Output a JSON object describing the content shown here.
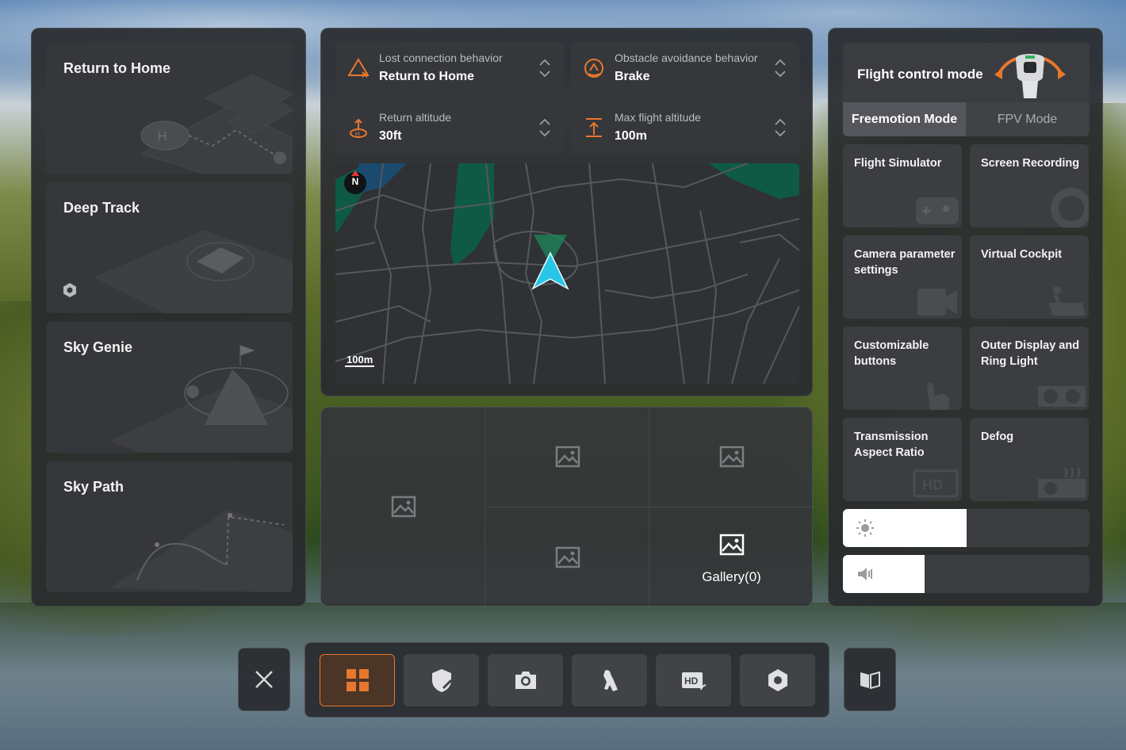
{
  "left_panel": {
    "modes": [
      {
        "label": "Return to Home"
      },
      {
        "label": "Deep Track"
      },
      {
        "label": "Sky Genie"
      },
      {
        "label": "Sky Path"
      }
    ]
  },
  "settings": {
    "lost_connection": {
      "label": "Lost connection behavior",
      "value": "Return to Home"
    },
    "obstacle_avoidance": {
      "label": "Obstacle avoidance behavior",
      "value": "Brake"
    },
    "return_altitude": {
      "label": "Return altitude",
      "value": "30ft"
    },
    "max_altitude": {
      "label": "Max flight altitude",
      "value": "100m"
    }
  },
  "map": {
    "compass": "N",
    "scale": "100m"
  },
  "gallery": {
    "label": "Gallery(0)"
  },
  "flight_control": {
    "title": "Flight control mode",
    "modes": [
      "Freemotion Mode",
      "FPV Mode"
    ],
    "selected": "Freemotion Mode"
  },
  "tiles": [
    {
      "label": "Flight Simulator",
      "icon": "gamepad-icon"
    },
    {
      "label": "Screen Recording",
      "icon": "record-icon"
    },
    {
      "label": "Camera parameter settings",
      "icon": "camera-icon"
    },
    {
      "label": "Virtual Cockpit",
      "icon": "cockpit-icon"
    },
    {
      "label": "Customizable buttons",
      "icon": "hand-button-icon"
    },
    {
      "label": "Outer Display and Ring Light",
      "icon": "goggles-icon"
    },
    {
      "label": "Transmission Aspect Ratio",
      "icon": "hd-icon"
    },
    {
      "label": "Defog",
      "icon": "defog-icon"
    }
  ],
  "sliders": {
    "brightness": 0.5,
    "volume": 0.33
  },
  "toolbar": {
    "items": [
      "dashboard-icon",
      "shield-icon",
      "camera-icon",
      "gesture-icon",
      "hd-transmission-icon",
      "settings-icon"
    ],
    "active": 0
  },
  "colors": {
    "accent": "#e8772e",
    "arrow": "#29c5e6",
    "green": "#0e5a45"
  }
}
